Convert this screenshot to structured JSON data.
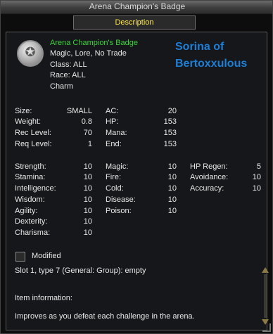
{
  "window": {
    "title": "Arena Champion's Badge"
  },
  "tab": {
    "label": "Description"
  },
  "item": {
    "name": "Arena Champion's Badge",
    "flags": "Magic, Lore, No Trade",
    "class_line": "Class:   ALL",
    "race_line": "Race:   ALL",
    "slot": "Charm"
  },
  "caption": {
    "line1": "Sorina of",
    "line2": "Bertoxxulous"
  },
  "stats_col1": [
    {
      "label": "Size:",
      "value": "SMALL"
    },
    {
      "label": "Weight:",
      "value": "0.8"
    },
    {
      "label": "Rec Level:",
      "value": "70"
    },
    {
      "label": "Req Level:",
      "value": "1"
    }
  ],
  "stats_col2": [
    {
      "label": "AC:",
      "value": "20"
    },
    {
      "label": "HP:",
      "value": "153"
    },
    {
      "label": "Mana:",
      "value": "153"
    },
    {
      "label": "End:",
      "value": "153"
    }
  ],
  "attributes": [
    {
      "label": "Strength:",
      "value": "10"
    },
    {
      "label": "Stamina:",
      "value": "10"
    },
    {
      "label": "Intelligence:",
      "value": "10"
    },
    {
      "label": "Wisdom:",
      "value": "10"
    },
    {
      "label": "Agility:",
      "value": "10"
    },
    {
      "label": "Dexterity:",
      "value": "10"
    },
    {
      "label": "Charisma:",
      "value": "10"
    }
  ],
  "resists": [
    {
      "label": "Magic:",
      "value": "10"
    },
    {
      "label": "Fire:",
      "value": "10"
    },
    {
      "label": "Cold:",
      "value": "10"
    },
    {
      "label": "Disease:",
      "value": "10"
    },
    {
      "label": "Poison:",
      "value": "10"
    }
  ],
  "mods": [
    {
      "label": "HP Regen:",
      "value": "5"
    },
    {
      "label": "Avoidance:",
      "value": "10"
    },
    {
      "label": "Accuracy:",
      "value": "10"
    }
  ],
  "modified": {
    "label": "Modified",
    "checked": false
  },
  "slot_info": "Slot 1, type 7 (General: Group): empty",
  "info_header": "Item information:",
  "info_text": "Improves as you defeat each challenge in the arena.",
  "icons": {
    "item": "badge-icon"
  }
}
